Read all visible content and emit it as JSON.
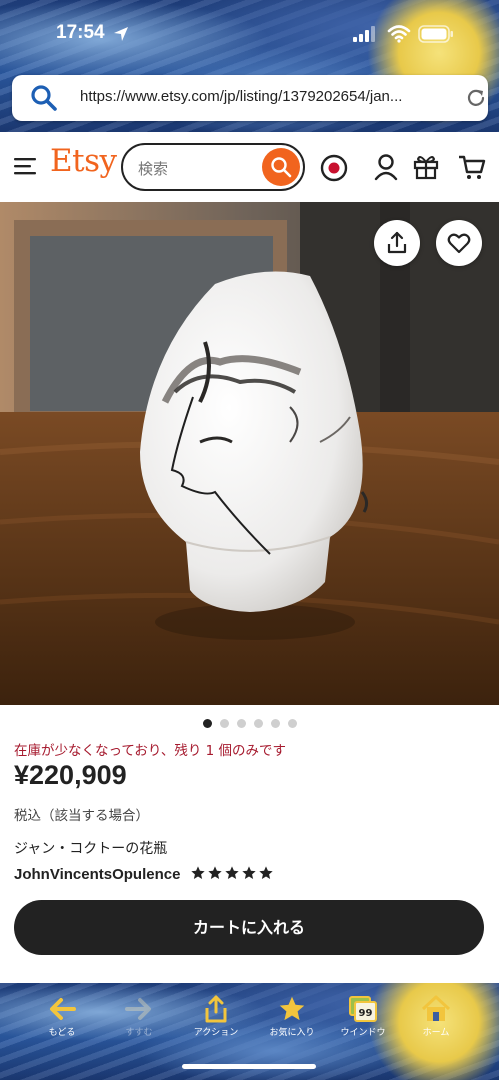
{
  "status_bar": {
    "time": "17:54"
  },
  "browser": {
    "url": "https://www.etsy.com/jp/listing/1379202654/jan..."
  },
  "header": {
    "logo": "Etsy",
    "search_placeholder": "検索"
  },
  "product": {
    "image_count": 6,
    "active_image": 1,
    "stock_note": "在庫が少なくなっており、残り 1 個のみです",
    "price": "¥220,909",
    "tax_note": "税込（該当する場合）",
    "title": "ジャン・コクトーの花瓶",
    "shop_name": "JohnVincentsOpulence",
    "rating_stars": 5,
    "add_to_cart": "カートに入れる"
  },
  "toolbar": {
    "back": "もどる",
    "forward": "すすむ",
    "action": "アクション",
    "favorites": "お気に入り",
    "tabs": "ウインドウ",
    "tabs_count": "99",
    "home": "ホーム"
  },
  "colors": {
    "brand": "#f1641e",
    "stock_warning": "#a61a2e",
    "button_dark": "#222222"
  }
}
